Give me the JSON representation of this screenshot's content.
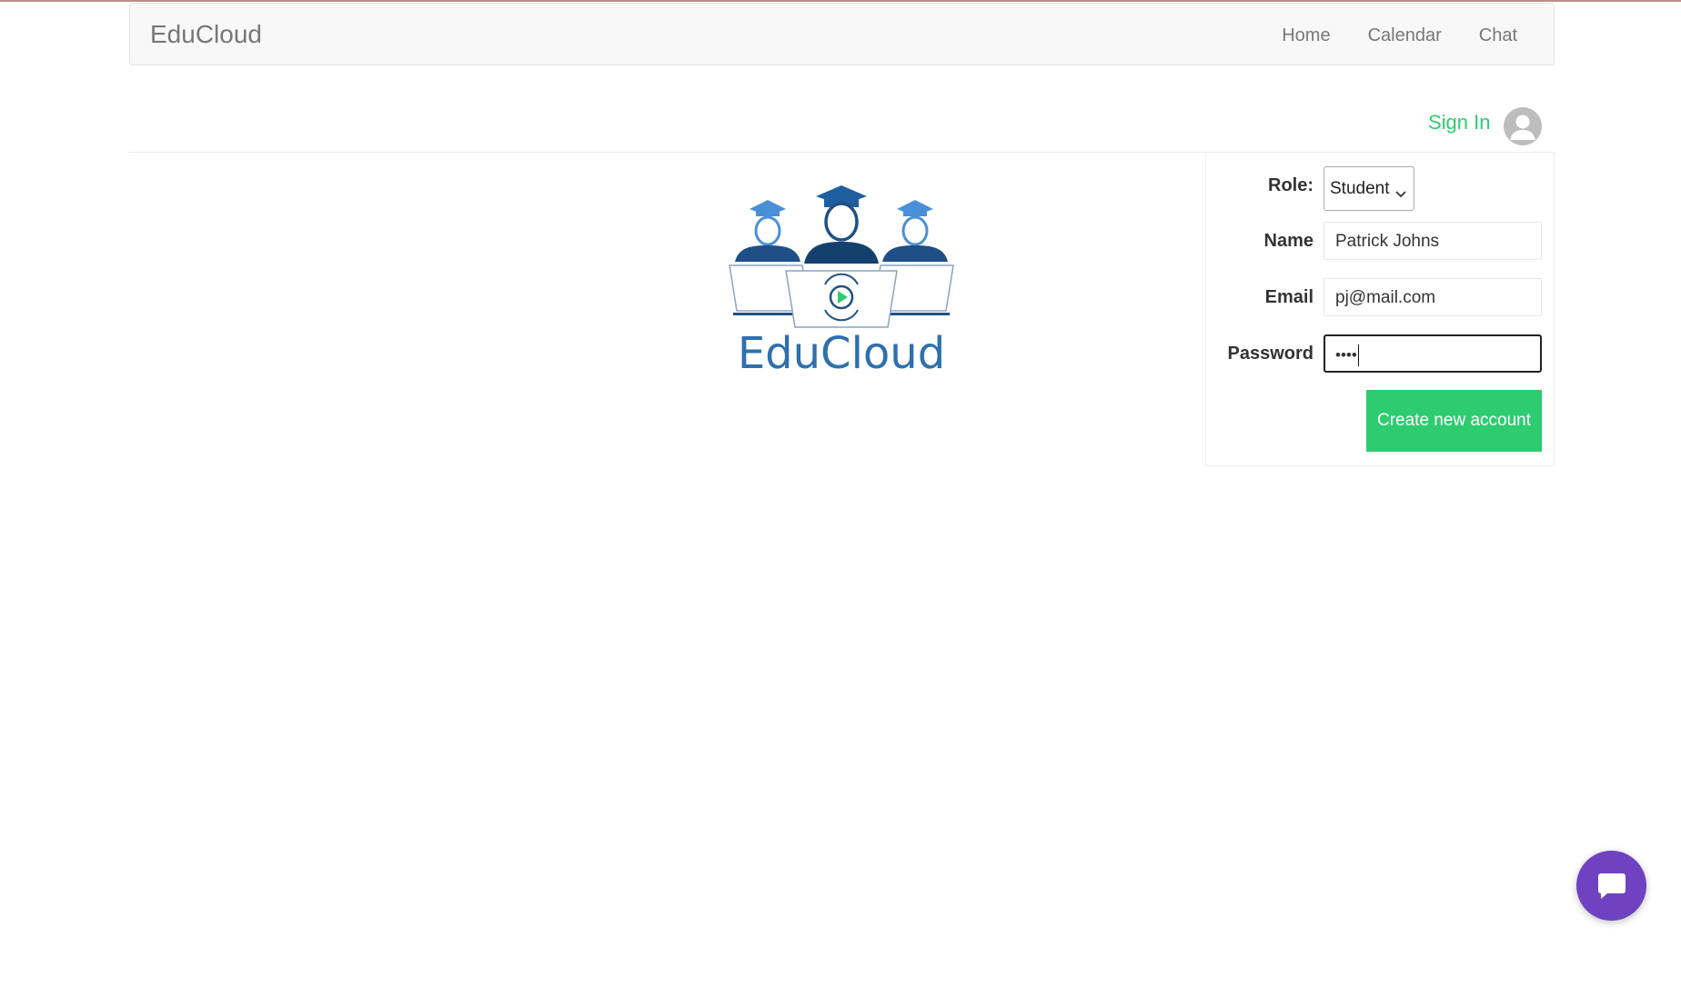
{
  "navbar": {
    "brand": "EduCloud",
    "links": [
      "Home",
      "Calendar",
      "Chat"
    ]
  },
  "auth": {
    "sign_in_label": "Sign In"
  },
  "logo": {
    "text": "EduCloud"
  },
  "form": {
    "role_label": "Role:",
    "role_value": "Student",
    "name_label": "Name",
    "name_value": "Patrick Johns",
    "email_label": "Email",
    "email_value": "pj@mail.com",
    "password_label": "Password",
    "password_value": "••••",
    "submit_label": "Create new account"
  },
  "colors": {
    "accent_green": "#2ecc71",
    "chat_purple": "#6f42c1",
    "logo_blue": "#2f6fae"
  },
  "icons": {
    "avatar": "user-avatar-icon",
    "chat": "chat-bubble-icon",
    "chevron": "chevron-down-icon"
  }
}
